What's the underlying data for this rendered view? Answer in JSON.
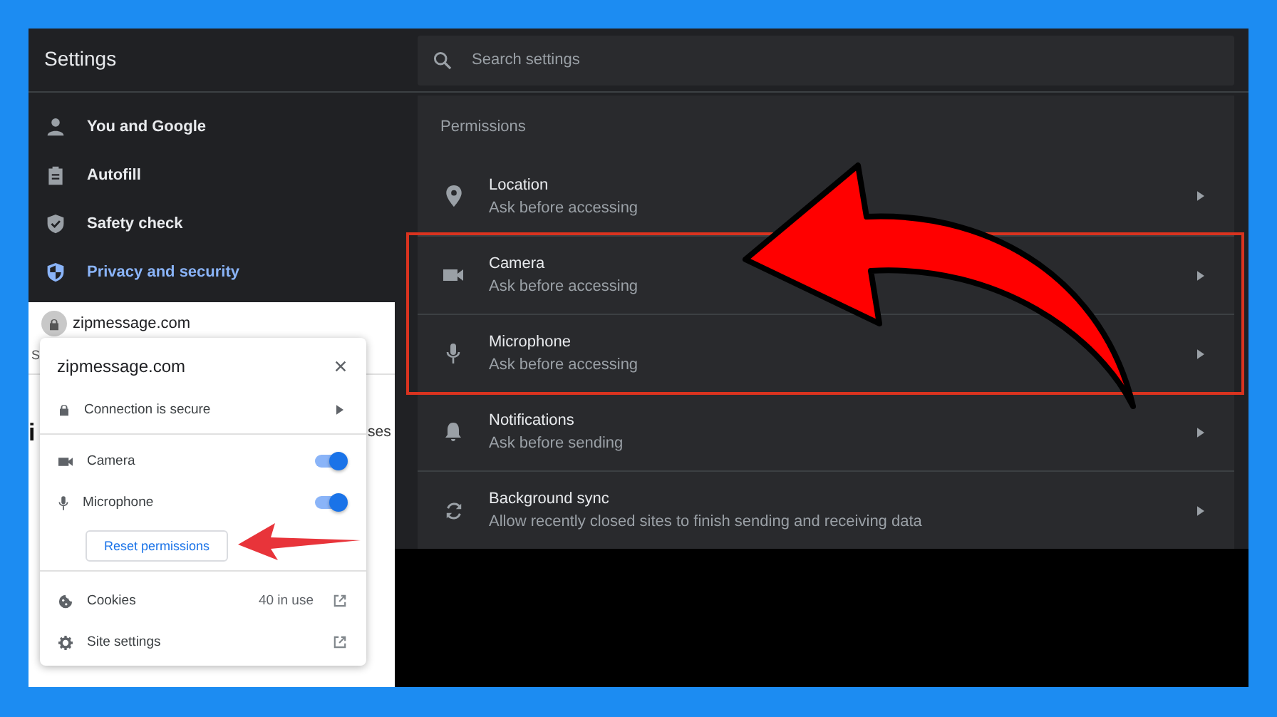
{
  "window": {
    "title": "Settings"
  },
  "search": {
    "placeholder": "Search settings"
  },
  "sidebar": {
    "items": [
      {
        "kind": "person",
        "label": "You and Google",
        "selected": false
      },
      {
        "kind": "clipboard",
        "label": "Autofill",
        "selected": false
      },
      {
        "kind": "shield-check",
        "label": "Safety check",
        "selected": false
      },
      {
        "kind": "shield",
        "label": "Privacy and security",
        "selected": true
      }
    ]
  },
  "permissions": {
    "heading": "Permissions",
    "rows": [
      {
        "kind": "location",
        "title": "Location",
        "subtitle": "Ask before accessing",
        "highlighted": false
      },
      {
        "kind": "camera",
        "title": "Camera",
        "subtitle": "Ask before accessing",
        "highlighted": true
      },
      {
        "kind": "microphone",
        "title": "Microphone",
        "subtitle": "Ask before accessing",
        "highlighted": true
      },
      {
        "kind": "bell",
        "title": "Notifications",
        "subtitle": "Ask before sending",
        "highlighted": false
      },
      {
        "kind": "sync",
        "title": "Background sync",
        "subtitle": "Allow recently closed sites to finish sending and receiving data",
        "highlighted": false
      }
    ]
  },
  "browser": {
    "address": "zipmessage.com",
    "page_fragments": [
      "S",
      "i",
      "ses"
    ]
  },
  "site_popup": {
    "site": "zipmessage.com",
    "connection": "Connection is secure",
    "permissions": [
      {
        "kind": "camera",
        "label": "Camera",
        "on": true
      },
      {
        "kind": "microphone",
        "label": "Microphone",
        "on": true
      }
    ],
    "reset_button": "Reset permissions",
    "links": [
      {
        "kind": "cookies",
        "label": "Cookies",
        "value": "40 in use"
      },
      {
        "kind": "settings",
        "label": "Site settings"
      }
    ]
  }
}
